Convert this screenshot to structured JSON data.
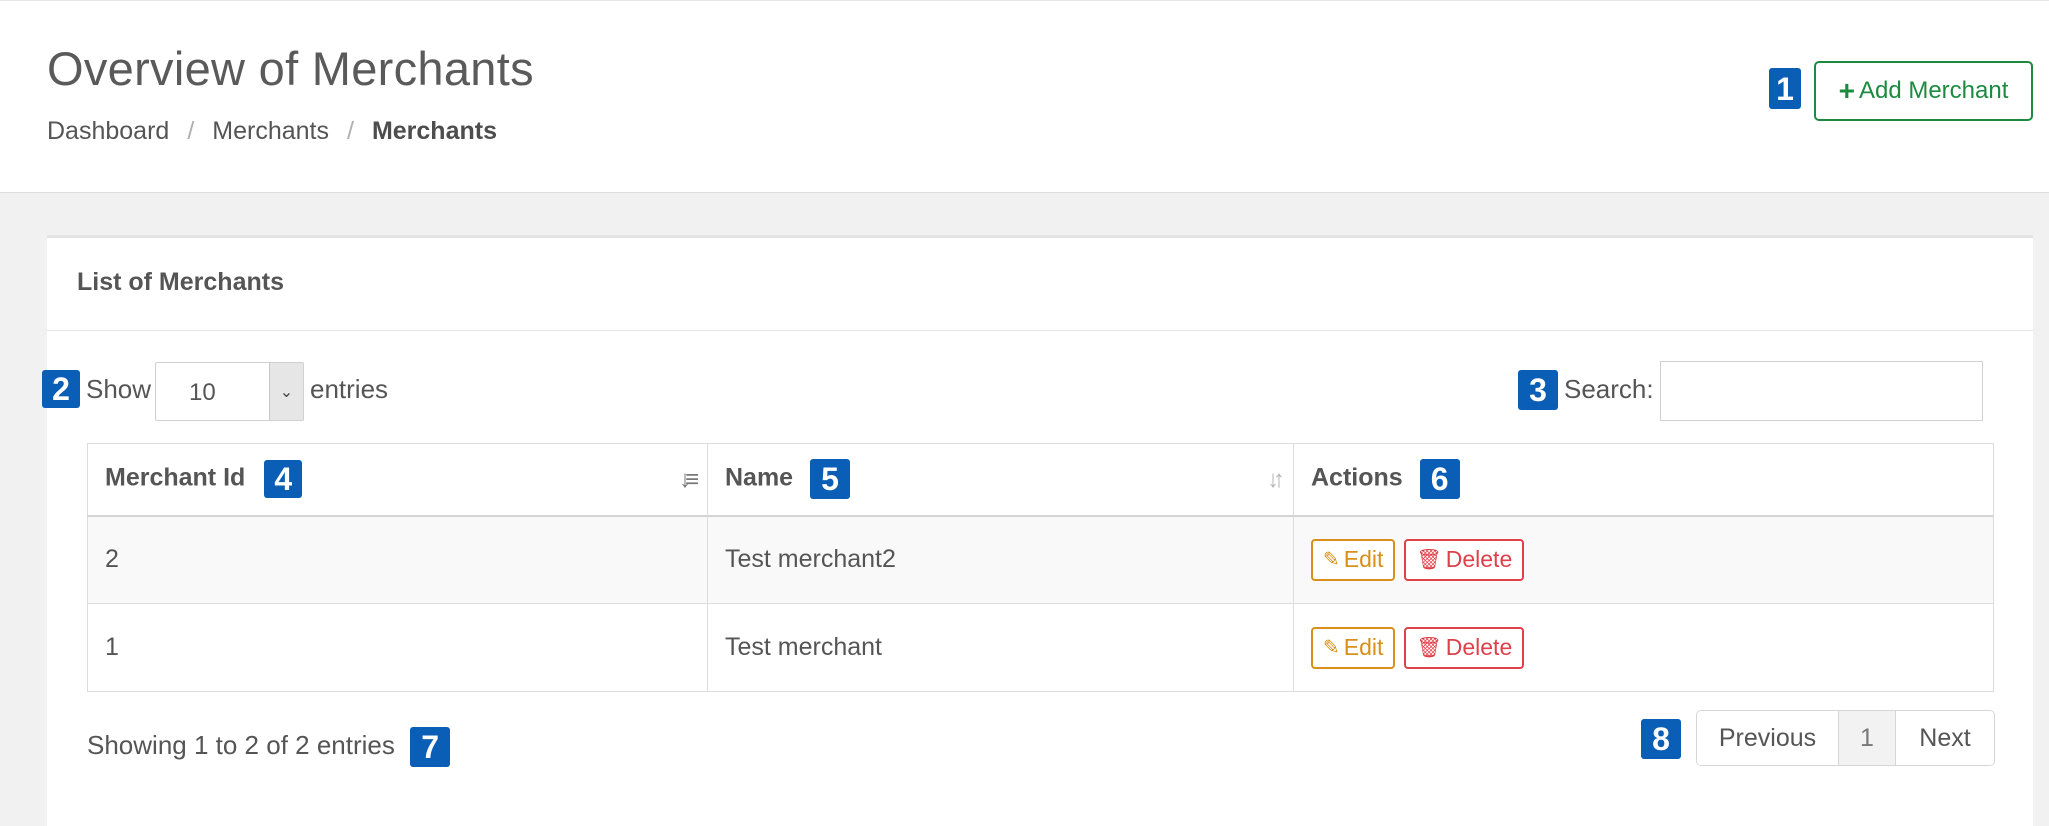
{
  "header": {
    "title": "Overview of Merchants",
    "breadcrumb": [
      "Dashboard",
      "Merchants",
      "Merchants"
    ],
    "add_button_label": "Add Merchant"
  },
  "badges": [
    "1",
    "2",
    "3",
    "4",
    "5",
    "6",
    "7",
    "8"
  ],
  "panel": {
    "title": "List of Merchants"
  },
  "controls": {
    "show_label": "Show",
    "page_length": "10",
    "entries_label": "entries",
    "search_label": "Search:",
    "search_value": ""
  },
  "table": {
    "columns": [
      "Merchant Id",
      "Name",
      "Actions"
    ],
    "rows": [
      {
        "id": "2",
        "name": "Test merchant2"
      },
      {
        "id": "1",
        "name": "Test merchant"
      }
    ],
    "edit_label": "Edit",
    "delete_label": "Delete"
  },
  "footer": {
    "info": "Showing 1 to 2 of 2 entries",
    "pagination": {
      "previous": "Previous",
      "page": "1",
      "next": "Next"
    }
  },
  "colors": {
    "badge": "#0a5eb5",
    "success": "#1c8a3f",
    "warning": "#d88f1c",
    "danger": "#e0404a"
  }
}
